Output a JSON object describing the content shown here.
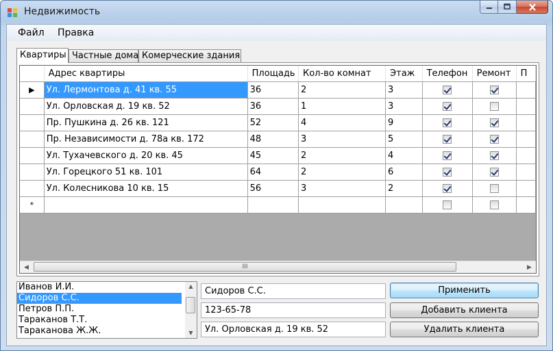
{
  "window": {
    "title": "Недвижимость"
  },
  "menu": {
    "items": [
      "Файл",
      "Правка"
    ]
  },
  "tabs": [
    {
      "label": "Квартиры",
      "active": true
    },
    {
      "label": "Частные дома",
      "active": false
    },
    {
      "label": "Комерческие здания",
      "active": false
    }
  ],
  "grid": {
    "columns": [
      "Адрес квартиры",
      "Площадь",
      "Кол-во комнат",
      "Этаж",
      "Телефон",
      "Ремонт",
      "П"
    ],
    "rows": [
      {
        "address": "Ул. Лермонтова д. 41 кв. 55",
        "area": "36",
        "rooms": "2",
        "floor": "3",
        "phone": true,
        "repair": true,
        "current": true
      },
      {
        "address": "Ул. Орловская д. 19 кв. 52",
        "area": "36",
        "rooms": "1",
        "floor": "3",
        "phone": true,
        "repair": false
      },
      {
        "address": "Пр. Пушкина д. 26 кв. 121",
        "area": "52",
        "rooms": "4",
        "floor": "9",
        "phone": true,
        "repair": true
      },
      {
        "address": "Пр. Независимости д. 78а кв. 172",
        "area": "48",
        "rooms": "3",
        "floor": "5",
        "phone": true,
        "repair": true
      },
      {
        "address": "Ул. Тухачевского д. 20 кв. 45",
        "area": "45",
        "rooms": "2",
        "floor": "4",
        "phone": true,
        "repair": true
      },
      {
        "address": "Ул. Горецкого 51 кв. 101",
        "area": "64",
        "rooms": "2",
        "floor": "6",
        "phone": true,
        "repair": true
      },
      {
        "address": "Ул. Колесникова 10 кв. 15",
        "area": "56",
        "rooms": "3",
        "floor": "2",
        "phone": true,
        "repair": false
      }
    ],
    "new_row_marker": "*",
    "current_row_marker": "▶",
    "scroll_thumb_label": "III"
  },
  "clients": {
    "items": [
      "Иванов И.И.",
      "Сидоров С.С.",
      "Петров П.П.",
      "Тараканов Т.Т.",
      "Тараканова Ж.Ж."
    ],
    "selected_index": 1
  },
  "fields": {
    "name": "Сидоров С.С.",
    "phone": "123-65-78",
    "address": "Ул. Орловская д. 19 кв. 52"
  },
  "buttons": {
    "apply": "Применить",
    "add_client": "Добавить клиента",
    "delete_client": "Удалить клиента"
  },
  "colors": {
    "selection": "#3399ff",
    "grid_bg": "#ababab"
  },
  "icons": {
    "app": "app-icon",
    "minimize": "minimize-icon",
    "maximize": "maximize-icon",
    "close": "close-icon"
  }
}
